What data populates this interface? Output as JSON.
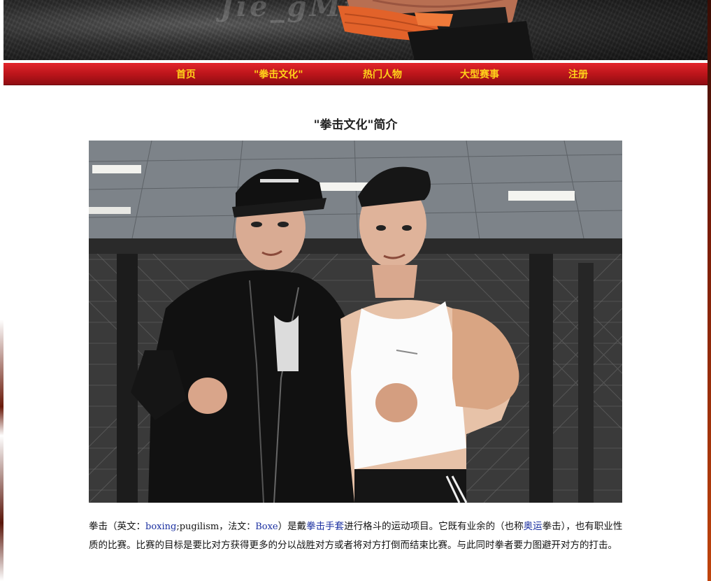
{
  "header": {
    "banner_text": "Jie_gMrcine"
  },
  "nav": {
    "items": [
      {
        "label": "首页"
      },
      {
        "label": "\"拳击文化\""
      },
      {
        "label": "热门人物"
      },
      {
        "label": "大型赛事"
      },
      {
        "label": "注册"
      }
    ]
  },
  "main": {
    "title": "\"拳击文化\"简介",
    "intro": {
      "t1": "拳击（英文：",
      "link_boxing": "boxing",
      "t2": ";pugilism，法文：",
      "link_boxe": "Boxe",
      "t3": "）是戴",
      "link_gloves": "拳击手套",
      "t4": "进行格斗的运动项目。它既有业余的（也称",
      "link_olympic": "奥运",
      "t5": "拳击），也有职业性质的比赛。比赛的目标是要比对方获得更多的分以战胜对方或者将对方打倒而结束比赛。与此同时拳者要力图避开对方的打击。"
    }
  },
  "colors": {
    "nav_bg": "#c8171d",
    "nav_text": "#ffd21a",
    "link": "#1a2fa0"
  }
}
